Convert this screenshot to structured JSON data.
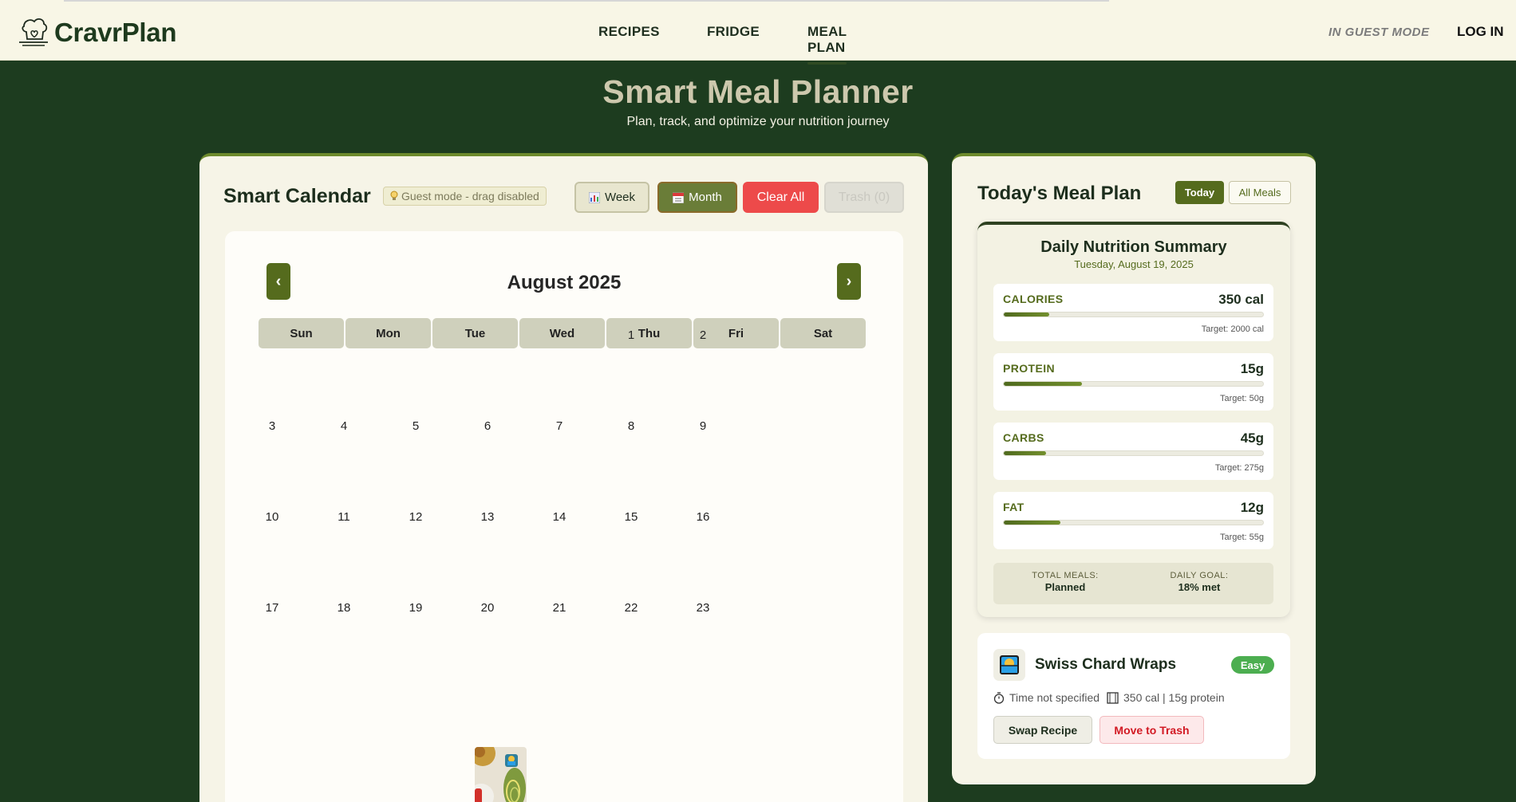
{
  "brand": {
    "name": "CravrPlan"
  },
  "nav": {
    "links": [
      {
        "label": "RECIPES",
        "active": false
      },
      {
        "label": "FRIDGE",
        "active": false
      },
      {
        "label": "MEAL PLAN",
        "active": true
      }
    ],
    "guest_label": "IN GUEST MODE",
    "login_label": "LOG IN"
  },
  "hero": {
    "title": "Smart Meal Planner",
    "subtitle": "Plan, track, and optimize your nutrition journey"
  },
  "calendar": {
    "title": "Smart Calendar",
    "guest_chip": "Guest mode - drag disabled",
    "buttons": {
      "week": "Week",
      "month": "Month",
      "clear": "Clear All",
      "trash": "Trash (0)"
    },
    "month_label": "August 2025",
    "prev_label": "‹",
    "next_label": "›",
    "weekdays": [
      "Sun",
      "Mon",
      "Tue",
      "Wed",
      "Thu",
      "Fri",
      "Sat"
    ],
    "days": [
      "1",
      "2",
      "3",
      "4",
      "5",
      "6",
      "7",
      "8",
      "9",
      "10",
      "11",
      "12",
      "13",
      "14",
      "15",
      "16",
      "17",
      "18",
      "19",
      "20",
      "21",
      "22",
      "23"
    ],
    "meal_on_day": "19"
  },
  "meal_plan": {
    "title": "Today's Meal Plan",
    "tabs": {
      "today": "Today",
      "all": "All Meals"
    },
    "summary": {
      "title": "Daily Nutrition Summary",
      "date": "Tuesday, August 19, 2025",
      "macros": [
        {
          "label": "CALORIES",
          "value": "350 cal",
          "target": "Target: 2000 cal",
          "progress": 0.175
        },
        {
          "label": "PROTEIN",
          "value": "15g",
          "target": "Target: 50g",
          "progress": 0.3
        },
        {
          "label": "CARBS",
          "value": "45g",
          "target": "Target: 275g",
          "progress": 0.164
        },
        {
          "label": "FAT",
          "value": "12g",
          "target": "Target: 55g",
          "progress": 0.218
        }
      ],
      "total_meals_label": "TOTAL MEALS:",
      "total_meals_value": "Planned",
      "daily_goal_label": "DAILY GOAL:",
      "daily_goal_value": "18% met"
    },
    "recipe": {
      "name": "Swiss Chard Wraps",
      "difficulty": "Easy",
      "time": "Time not specified",
      "nutrition": "350 cal | 15g protein",
      "swap_label": "Swap Recipe",
      "trash_label": "Move to Trash"
    }
  }
}
